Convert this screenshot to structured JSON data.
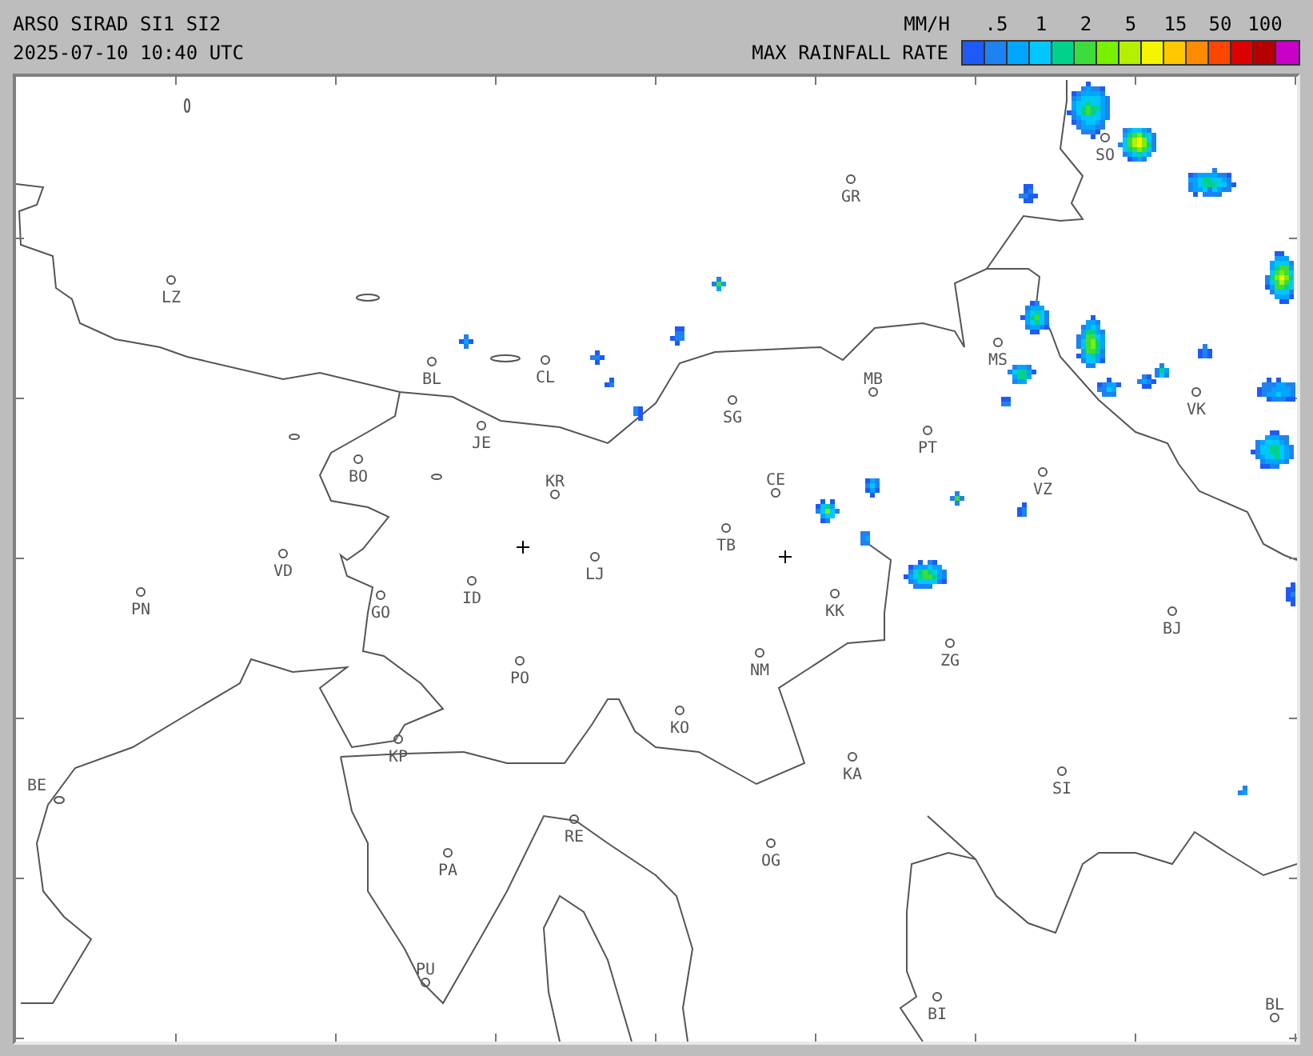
{
  "header": {
    "title": "ARSO SIRAD SI1 SI2",
    "timestamp": "2025-07-10 10:40 UTC"
  },
  "legend": {
    "unit": "MM/H",
    "caption": "MAX RAINFALL RATE",
    "ticks": [
      ".5",
      "1",
      "2",
      "5",
      "15",
      "50",
      "100"
    ],
    "swatches": [
      {
        "color": "#1e5af5"
      },
      {
        "color": "#1e82f0"
      },
      {
        "color": "#00a5ff"
      },
      {
        "color": "#00c8ff"
      },
      {
        "color": "#00d28c"
      },
      {
        "color": "#3cdc3c"
      },
      {
        "color": "#78f000"
      },
      {
        "color": "#b4f000"
      },
      {
        "color": "#f5f500"
      },
      {
        "color": "#ffc800"
      },
      {
        "color": "#ff8c00"
      },
      {
        "color": "#ff4600"
      },
      {
        "color": "#dc0000"
      },
      {
        "color": "#b40000"
      },
      {
        "color": "#c800c8"
      }
    ]
  },
  "cities": [
    {
      "label": "LZ"
    },
    {
      "label": "BL"
    },
    {
      "label": "CL"
    },
    {
      "label": "GR"
    },
    {
      "label": "SO"
    },
    {
      "label": "SG"
    },
    {
      "label": "MB"
    },
    {
      "label": "JE"
    },
    {
      "label": "MS"
    },
    {
      "label": "PT"
    },
    {
      "label": "VK"
    },
    {
      "label": "BO"
    },
    {
      "label": "KR"
    },
    {
      "label": "CE"
    },
    {
      "label": "VZ"
    },
    {
      "label": "TB"
    },
    {
      "label": "LJ"
    },
    {
      "label": "VD"
    },
    {
      "label": "ID"
    },
    {
      "label": "PN"
    },
    {
      "label": "GO"
    },
    {
      "label": "KK"
    },
    {
      "label": "BJ"
    },
    {
      "label": "ZG"
    },
    {
      "label": "NM"
    },
    {
      "label": "PO"
    },
    {
      "label": "KO"
    },
    {
      "label": "KP"
    },
    {
      "label": "KA"
    },
    {
      "label": "SI"
    },
    {
      "label": "BE"
    },
    {
      "label": "RE"
    },
    {
      "label": "PA"
    },
    {
      "label": "OG"
    },
    {
      "label": "PU"
    },
    {
      "label": "BI"
    },
    {
      "label": "BL"
    }
  ]
}
